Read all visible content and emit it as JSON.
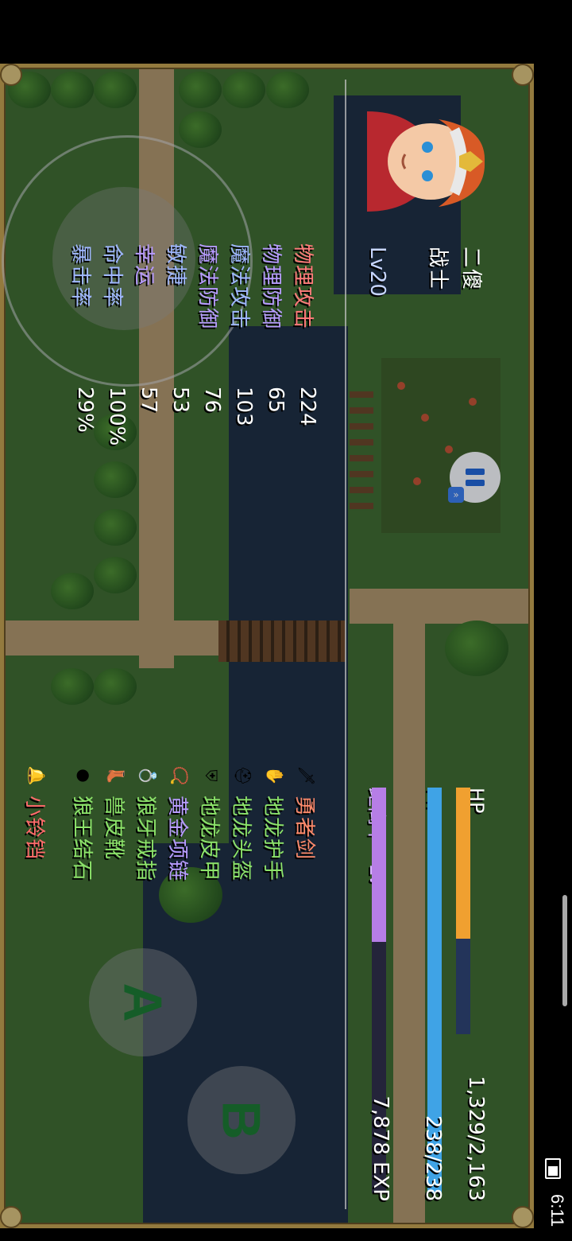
{
  "status_bar": {
    "time": "6:11"
  },
  "character": {
    "name": "二傻",
    "class": "战士",
    "level": "Lv20"
  },
  "stats": [
    {
      "label": "物理攻击",
      "value": "224",
      "color": "#ff7a7a"
    },
    {
      "label": "物理防御",
      "value": "65",
      "color": "#b79bff"
    },
    {
      "label": "魔法攻击",
      "value": "103",
      "color": "#9fb7ff"
    },
    {
      "label": "魔法防御",
      "value": "76",
      "color": "#b79bff"
    },
    {
      "label": "敏捷",
      "value": "53",
      "color": "#9fb7ff"
    },
    {
      "label": "幸运",
      "value": "57",
      "color": "#b79bff"
    },
    {
      "label": "命中率",
      "value": "100%",
      "color": "#9fb7ff"
    },
    {
      "label": "暴击率",
      "value": "29%",
      "color": "#9fb7ff"
    }
  ],
  "bars": {
    "hp": {
      "label": "HP",
      "text": "1,329/2,163",
      "current": 1329,
      "max": 2163,
      "color": "#f0a030"
    },
    "mp": {
      "label": "MP",
      "text": "238/238",
      "current": 238,
      "max": 238,
      "color": "#3fa3e6"
    },
    "exp": {
      "label": "距离下一Lv",
      "text": "7,878 EXP",
      "fraction": 0.38,
      "color": "#b67ee6"
    }
  },
  "equipment": [
    {
      "name": "勇者剑",
      "icon": "sword-icon",
      "glyph": "🗡",
      "color": "#ff8a6a"
    },
    {
      "name": "地龙护手",
      "icon": "gauntlet-icon",
      "glyph": "✋",
      "color": "#8ce36a"
    },
    {
      "name": "地龙头盔",
      "icon": "helmet-icon",
      "glyph": "⛑",
      "color": "#8ce36a"
    },
    {
      "name": "地龙皮甲",
      "icon": "armor-icon",
      "glyph": "⛨",
      "color": "#8ce36a"
    },
    {
      "name": "黄金项链",
      "icon": "necklace-icon",
      "glyph": "📿",
      "color": "#b79bff"
    },
    {
      "name": "狼牙戒指",
      "icon": "ring-icon",
      "glyph": "💍",
      "color": "#8ce36a"
    },
    {
      "name": "兽皮靴",
      "icon": "boots-icon",
      "glyph": "👢",
      "color": "#8ce36a"
    },
    {
      "name": "狼王结石",
      "icon": "stone-icon",
      "glyph": "●",
      "color": "#8ce36a"
    },
    {
      "name": "小铃铛",
      "icon": "bell-icon",
      "glyph": "🔔",
      "color": "#ff6a6a"
    }
  ],
  "controls": {
    "a_label": "A",
    "b_label": "B"
  }
}
